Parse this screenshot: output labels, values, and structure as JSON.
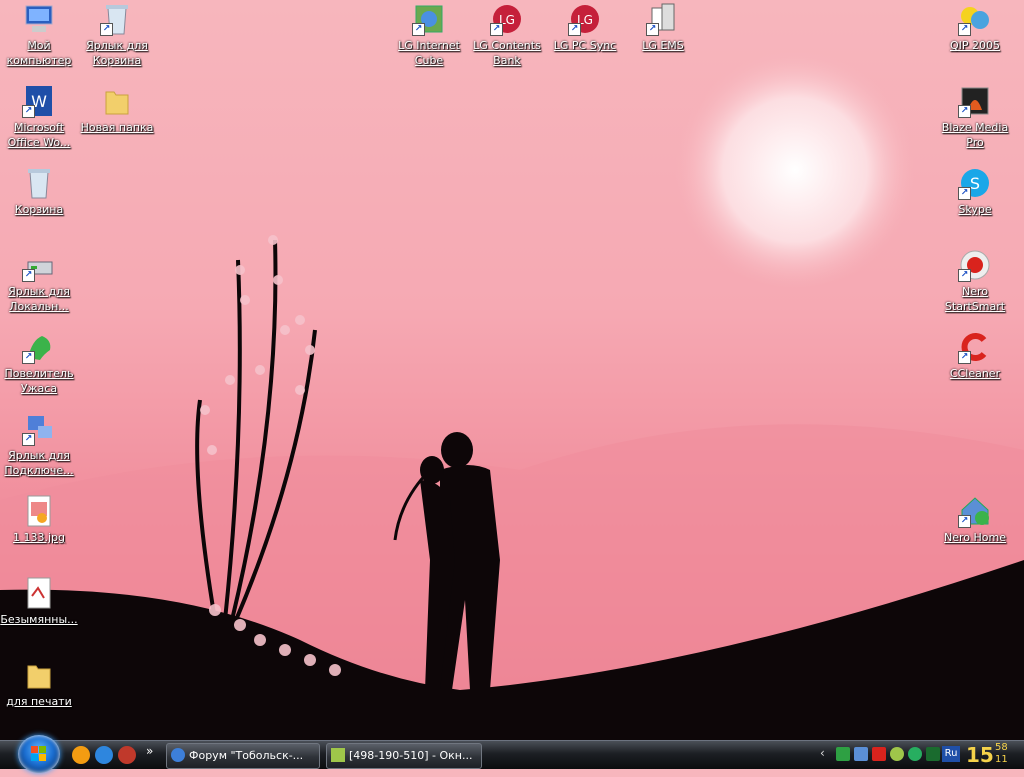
{
  "desktop": {
    "left_icons": [
      {
        "label": "Мой\nкомпьютер",
        "icon": "computer-icon"
      },
      {
        "label": "Microsoft\nOffice Wo...",
        "icon": "word-icon"
      },
      {
        "label": "Корзина",
        "icon": "recycle-bin-icon"
      },
      {
        "label": "Ярлык для\nЛокальн...",
        "icon": "network-drive-icon"
      },
      {
        "label": "Повелитель\nУжаса",
        "icon": "dragon-icon"
      },
      {
        "label": "Ярлык для\nПодключе...",
        "icon": "network-connection-icon"
      },
      {
        "label": "1 133.jpg",
        "icon": "jpg-file-icon"
      },
      {
        "label": "Безымянны...",
        "icon": "image-file-icon"
      },
      {
        "label": "для печати",
        "icon": "folder-icon"
      }
    ],
    "second_column_icons": [
      {
        "label": "Ярлык для\nКорзина",
        "icon": "recycle-bin-shortcut-icon"
      },
      {
        "label": "Новая папка",
        "icon": "folder-icon"
      }
    ],
    "top_icons": [
      {
        "label": "LG Internet\nCube",
        "icon": "lg-internet-cube-icon"
      },
      {
        "label": "LG Contents\nBank",
        "icon": "lg-logo-icon"
      },
      {
        "label": "LG PC Sync",
        "icon": "lg-logo-icon"
      },
      {
        "label": "LG EMS",
        "icon": "lg-ems-icon"
      }
    ],
    "right_icons": [
      {
        "label": "QIP 2005",
        "icon": "qip-icon"
      },
      {
        "label": "Blaze Media\nPro",
        "icon": "blaze-media-icon"
      },
      {
        "label": "Skype",
        "icon": "skype-icon"
      },
      {
        "label": "Nero\nStartSmart",
        "icon": "nero-icon"
      },
      {
        "label": "CCleaner",
        "icon": "ccleaner-icon"
      },
      {
        "label": "Nero Home",
        "icon": "nero-home-icon"
      }
    ]
  },
  "taskbar": {
    "windows": [
      {
        "label": "Форум \"Тобольск-...",
        "icon": "ie-icon"
      },
      {
        "label": "[498-190-510] - Окн...",
        "icon": "chat-window-icon"
      }
    ],
    "tray": {
      "language": "Ru",
      "clock_hour": "15",
      "clock_min_1": "58",
      "clock_min_2": "11"
    }
  },
  "colors": {
    "wallpaper_top": "#f7b6bd",
    "wallpaper_bottom": "#e97486",
    "silhouette": "#0d0608",
    "taskbar": "#1c1f24",
    "clock": "#f5d24a"
  }
}
